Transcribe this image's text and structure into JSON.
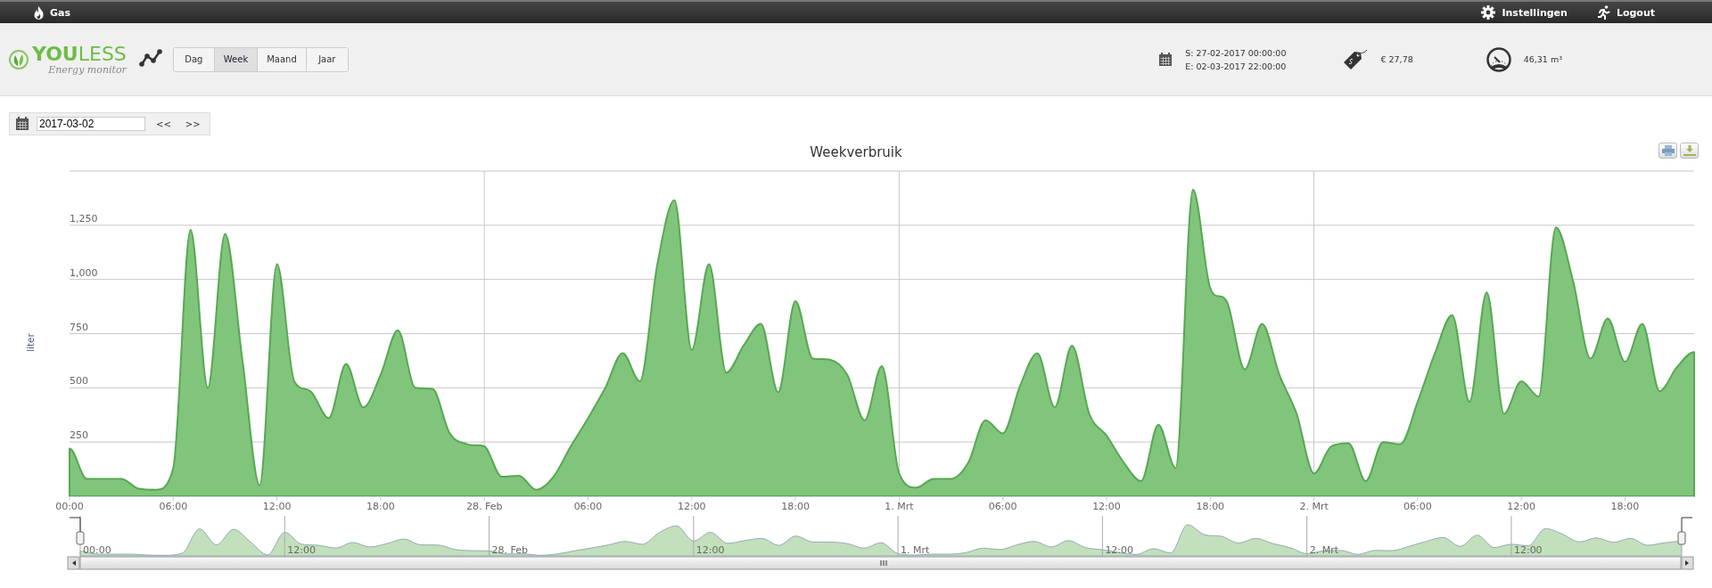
{
  "top_bar": {
    "section": "Gas",
    "settings": "Instellingen",
    "logout": "Logout"
  },
  "header": {
    "logo": {
      "title": "**YOU**LESS",
      "subtitle": "Energy monitor"
    },
    "periods": [
      {
        "label": "Dag",
        "selected": false
      },
      {
        "label": "Week",
        "selected": true
      },
      {
        "label": "Maand",
        "selected": false
      },
      {
        "label": "Jaar",
        "selected": false
      }
    ],
    "start": "S: 27-02-2017 00:00:00",
    "end": "E: 02-03-2017 22:00:00",
    "cost": "€ 27,78",
    "usage": "46,31 m³"
  },
  "date_picker": {
    "value": "2017-03-02",
    "prev": "<<",
    "next": ">>"
  },
  "chart": {
    "chart_data": {
      "type": "area",
      "title": "Weekverbruik",
      "ylabel": "liter",
      "x": [
        "2017-02-27T00:00",
        "2017-02-27T01:00",
        "2017-02-27T02:00",
        "2017-02-27T03:00",
        "2017-02-27T04:00",
        "2017-02-27T05:00",
        "2017-02-27T06:00",
        "2017-02-27T07:00",
        "2017-02-27T08:00",
        "2017-02-27T09:00",
        "2017-02-27T10:00",
        "2017-02-27T11:00",
        "2017-02-27T12:00",
        "2017-02-27T13:00",
        "2017-02-27T14:00",
        "2017-02-27T15:00",
        "2017-02-27T16:00",
        "2017-02-27T17:00",
        "2017-02-27T18:00",
        "2017-02-27T19:00",
        "2017-02-27T20:00",
        "2017-02-27T21:00",
        "2017-02-27T22:00",
        "2017-02-27T23:00",
        "2017-02-28T00:00",
        "2017-02-28T01:00",
        "2017-02-28T02:00",
        "2017-02-28T03:00",
        "2017-02-28T04:00",
        "2017-02-28T05:00",
        "2017-02-28T06:00",
        "2017-02-28T07:00",
        "2017-02-28T08:00",
        "2017-02-28T09:00",
        "2017-02-28T10:00",
        "2017-02-28T11:00",
        "2017-02-28T12:00",
        "2017-02-28T13:00",
        "2017-02-28T14:00",
        "2017-02-28T15:00",
        "2017-02-28T16:00",
        "2017-02-28T17:00",
        "2017-02-28T18:00",
        "2017-02-28T19:00",
        "2017-02-28T20:00",
        "2017-02-28T21:00",
        "2017-02-28T22:00",
        "2017-02-28T23:00",
        "2017-03-01T00:00",
        "2017-03-01T01:00",
        "2017-03-01T02:00",
        "2017-03-01T03:00",
        "2017-03-01T04:00",
        "2017-03-01T05:00",
        "2017-03-01T06:00",
        "2017-03-01T07:00",
        "2017-03-01T08:00",
        "2017-03-01T09:00",
        "2017-03-01T10:00",
        "2017-03-01T11:00",
        "2017-03-01T12:00",
        "2017-03-01T13:00",
        "2017-03-01T14:00",
        "2017-03-01T15:00",
        "2017-03-01T16:00",
        "2017-03-01T17:00",
        "2017-03-01T18:00",
        "2017-03-01T19:00",
        "2017-03-01T20:00",
        "2017-03-01T21:00",
        "2017-03-01T22:00",
        "2017-03-01T23:00",
        "2017-03-02T00:00",
        "2017-03-02T01:00",
        "2017-03-02T02:00",
        "2017-03-02T03:00",
        "2017-03-02T04:00",
        "2017-03-02T05:00",
        "2017-03-02T06:00",
        "2017-03-02T07:00",
        "2017-03-02T08:00",
        "2017-03-02T09:00",
        "2017-03-02T10:00",
        "2017-03-02T11:00",
        "2017-03-02T12:00",
        "2017-03-02T13:00",
        "2017-03-02T14:00",
        "2017-03-02T15:00",
        "2017-03-02T16:00",
        "2017-03-02T17:00",
        "2017-03-02T18:00",
        "2017-03-02T19:00",
        "2017-03-02T20:00",
        "2017-03-02T21:00",
        "2017-03-02T22:00"
      ],
      "series": [
        {
          "color": "#81c57c",
          "values": [
            220,
            80,
            80,
            80,
            35,
            30,
            130,
            1230,
            500,
            1210,
            630,
            50,
            1070,
            530,
            480,
            360,
            610,
            410,
            560,
            765,
            500,
            495,
            290,
            240,
            230,
            90,
            95,
            30,
            90,
            230,
            360,
            500,
            660,
            530,
            1065,
            1365,
            675,
            1070,
            570,
            695,
            795,
            480,
            900,
            635,
            630,
            560,
            350,
            600,
            105,
            40,
            80,
            80,
            155,
            350,
            290,
            510,
            660,
            410,
            695,
            380,
            280,
            155,
            70,
            330,
            130,
            1415,
            960,
            890,
            585,
            795,
            560,
            380,
            105,
            230,
            245,
            70,
            250,
            240,
            435,
            660,
            835,
            435,
            940,
            380,
            530,
            460,
            1240,
            990,
            635,
            820,
            620,
            795,
            485,
            595,
            665
          ]
        }
      ],
      "xlim": [
        "2017-02-27T00:00",
        "2017-03-02T22:00"
      ],
      "ylim": [
        0,
        1500
      ],
      "grid": true,
      "xticks": [
        {
          "value": "2017-02-27T00:00",
          "label": "00:00"
        },
        {
          "value": "2017-02-27T06:00",
          "label": "06:00"
        },
        {
          "value": "2017-02-27T12:00",
          "label": "12:00"
        },
        {
          "value": "2017-02-27T18:00",
          "label": "18:00"
        },
        {
          "value": "2017-02-28T00:00",
          "label": "28. Feb"
        },
        {
          "value": "2017-02-28T06:00",
          "label": "06:00"
        },
        {
          "value": "2017-02-28T12:00",
          "label": "12:00"
        },
        {
          "value": "2017-02-28T18:00",
          "label": "18:00"
        },
        {
          "value": "2017-03-01T00:00",
          "label": "1. Mrt"
        },
        {
          "value": "2017-03-01T06:00",
          "label": "06:00"
        },
        {
          "value": "2017-03-01T12:00",
          "label": "12:00"
        },
        {
          "value": "2017-03-01T18:00",
          "label": "18:00"
        },
        {
          "value": "2017-03-02T00:00",
          "label": "2. Mrt"
        },
        {
          "value": "2017-03-02T06:00",
          "label": "06:00"
        },
        {
          "value": "2017-03-02T12:00",
          "label": "12:00"
        },
        {
          "value": "2017-03-02T18:00",
          "label": "18:00"
        }
      ],
      "yticks": [
        {
          "value": 250,
          "label": "250"
        },
        {
          "value": 500,
          "label": "500"
        },
        {
          "value": 750,
          "label": "750"
        },
        {
          "value": 1000,
          "label": "1,000"
        },
        {
          "value": 1250,
          "label": "1,250"
        }
      ]
    },
    "navigator": {
      "labels": [
        "00:00",
        "12:00",
        "28. Feb",
        "12:00",
        "1. Mrt",
        "12:00",
        "2. Mrt",
        "12:00"
      ]
    }
  }
}
